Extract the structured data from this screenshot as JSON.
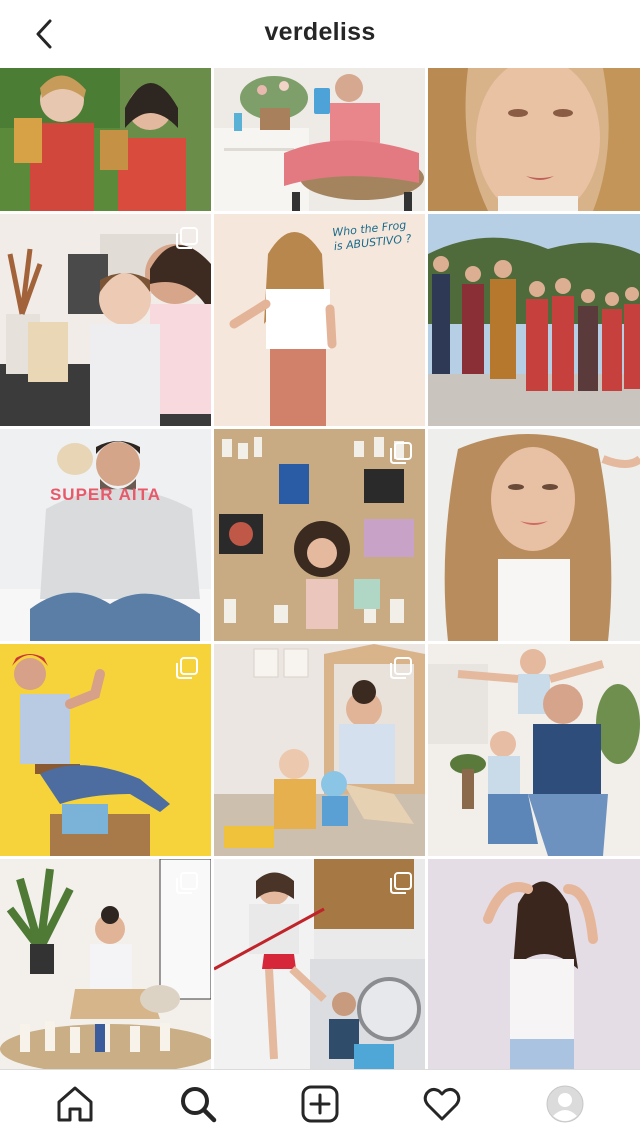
{
  "header": {
    "username": "verdeliss",
    "back_icon": "chevron-left-icon"
  },
  "grid": {
    "posts": [
      {
        "subject": "two kids in red overalls",
        "multi": false
      },
      {
        "subject": "woman in gingham on rattan chair",
        "multi": false
      },
      {
        "subject": "close-up woman with wavy hair",
        "multi": false
      },
      {
        "subject": "woman with toddler in kitchen",
        "multi": true
      },
      {
        "subject": "woman in white tee pink leggings",
        "multi": false,
        "handwriting": "Who the Frog is ABUSTIVO ?"
      },
      {
        "subject": "large family outdoors",
        "multi": false
      },
      {
        "subject": "man in grey hoodie",
        "multi": false,
        "caption": "SUPER AITA"
      },
      {
        "subject": "woman lying among beauty products",
        "multi": true
      },
      {
        "subject": "woman with long curly hair",
        "multi": false
      },
      {
        "subject": "woman posing on yellow background",
        "multi": true
      },
      {
        "subject": "woman with toddler and toy bus",
        "multi": true
      },
      {
        "subject": "man with two kids",
        "multi": false
      },
      {
        "subject": "woman with products on rug",
        "multi": true
      },
      {
        "subject": "woman with broom and man at washer",
        "multi": true
      },
      {
        "subject": "woman in white tank top",
        "multi": false
      }
    ]
  },
  "bottom_nav": {
    "items": [
      {
        "icon": "home-icon"
      },
      {
        "icon": "search-icon"
      },
      {
        "icon": "plus-square-icon"
      },
      {
        "icon": "heart-icon"
      },
      {
        "icon": "profile-avatar-icon"
      }
    ]
  },
  "colors": {
    "text": "#262626",
    "border": "#dbdbdb",
    "background": "#ffffff",
    "yellow_bg": "#f6d33a"
  }
}
